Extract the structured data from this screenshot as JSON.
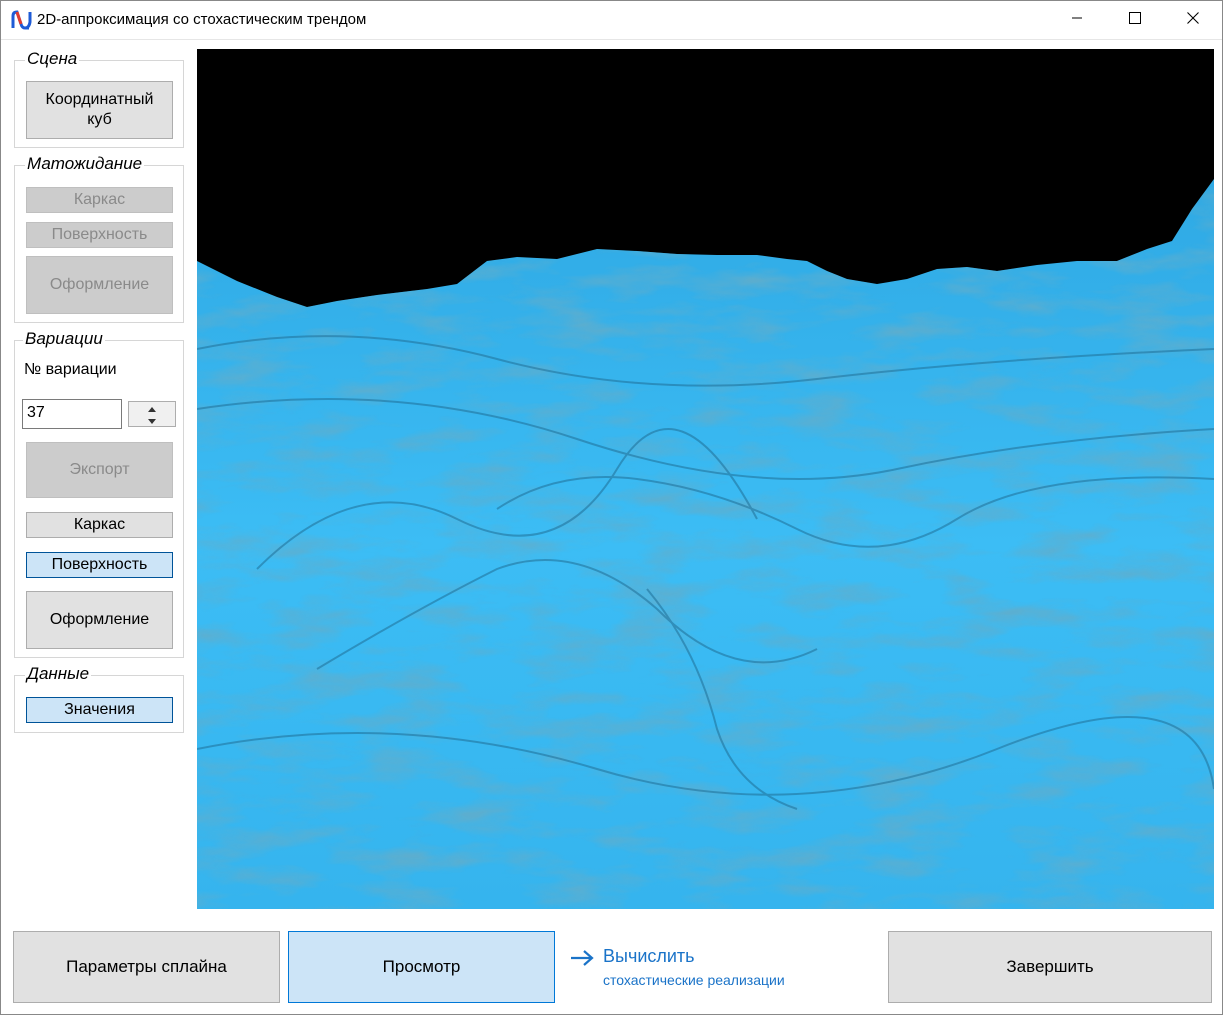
{
  "window": {
    "title": "2D-аппроксимация со стохастическим трендом",
    "controls": [
      "minimize-icon",
      "maximize-icon",
      "close-icon"
    ]
  },
  "scene": {
    "title": "Сцена",
    "coord_cube_label": "Координатный\nкуб"
  },
  "expectation": {
    "title": "Матожидание",
    "frame_label": "Каркас",
    "surface_label": "Поверхность",
    "style_label": "Оформление"
  },
  "variations": {
    "title": "Вариации",
    "number_label": "№ вариации",
    "number_value": "37",
    "export_label": "Экспорт",
    "frame_label": "Каркас",
    "surface_label": "Поверхность",
    "style_label": "Оформление"
  },
  "data_group": {
    "title": "Данные",
    "values_label": "Значения"
  },
  "footer": {
    "spline_params_label": "Параметры сплайна",
    "view_label": "Просмотр",
    "compute_title": "Вычислить",
    "compute_subtitle": "стохастические реализации",
    "finish_label": "Завершить"
  },
  "colors": {
    "surface": "#38b8f2",
    "surface_shadow": "#1f6f97",
    "viewport_bg": "#000000",
    "accent": "#1a73c8",
    "active_button": "#cce4f7"
  }
}
